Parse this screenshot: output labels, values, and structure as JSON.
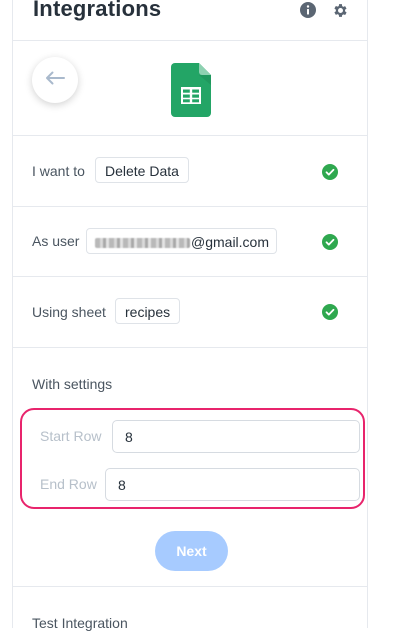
{
  "header": {
    "title": "Integrations",
    "info_icon": "info-circle-icon",
    "settings_icon": "gear-icon"
  },
  "app_logo": "google-sheets-icon",
  "steps": {
    "action": {
      "label": "I want to",
      "value": "Delete Data",
      "status": "complete"
    },
    "user": {
      "label": "As user",
      "value_suffix": "@gmail.com",
      "status": "complete"
    },
    "sheet": {
      "label": "Using sheet",
      "value": "recipes",
      "status": "complete"
    }
  },
  "settings": {
    "title": "With settings",
    "start_row": {
      "label": "Start Row",
      "value": "8"
    },
    "end_row": {
      "label": "End Row",
      "value": "8"
    }
  },
  "next_label": "Next",
  "test_section_title": "Test Integration",
  "colors": {
    "accent_highlight": "#e8246c",
    "check_green": "#2fa84f",
    "next_button": "#a7cbff",
    "sheets_green": "#23a566"
  }
}
